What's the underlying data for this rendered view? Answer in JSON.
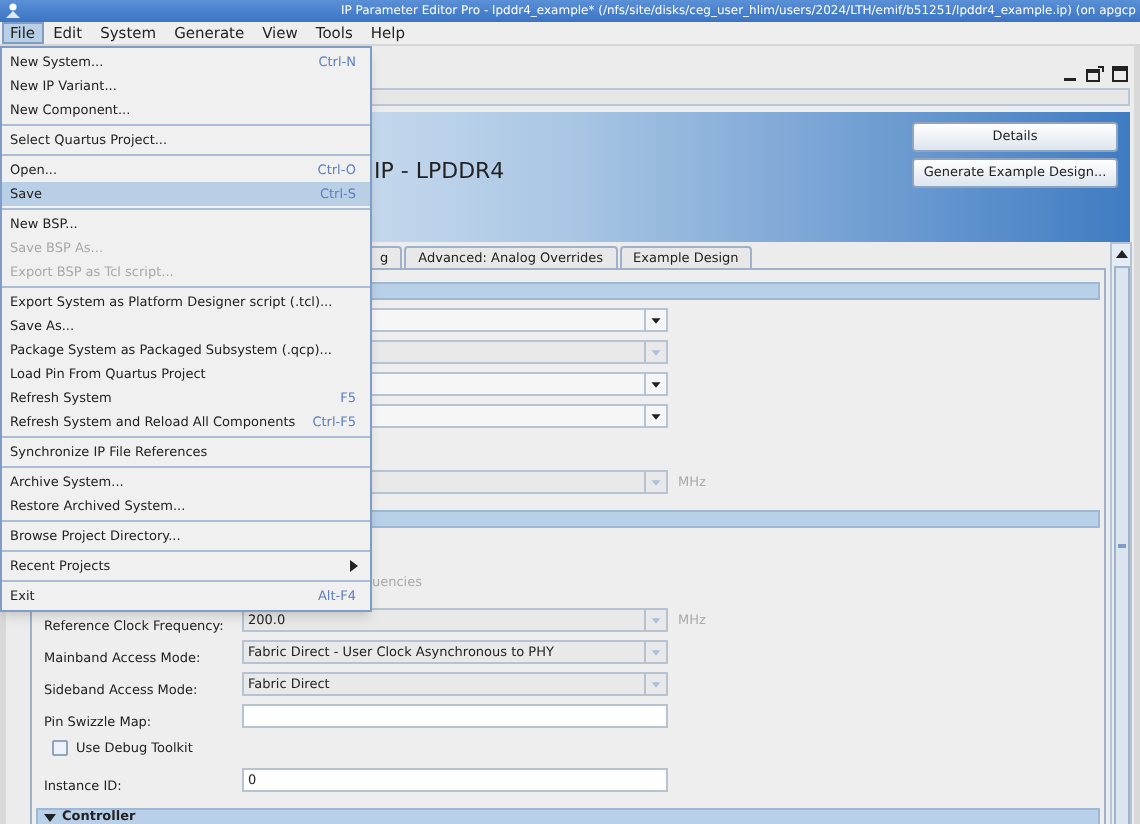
{
  "window": {
    "title": "IP Parameter Editor Pro - lpddr4_example* (/nfs/site/disks/ceg_user_hlim/users/2024/LTH/emif/b51251/lpddr4_example.ip) (on apgcp"
  },
  "menu_bar": [
    {
      "label": "File",
      "selected": true
    },
    {
      "label": "Edit",
      "selected": false
    },
    {
      "label": "System",
      "selected": false
    },
    {
      "label": "Generate",
      "selected": false
    },
    {
      "label": "View",
      "selected": false
    },
    {
      "label": "Tools",
      "selected": false
    },
    {
      "label": "Help",
      "selected": false
    }
  ],
  "file_menu": {
    "groups": [
      [
        {
          "label": "New System...",
          "shortcut": "Ctrl-N",
          "disabled": false,
          "selected": false
        },
        {
          "label": "New IP Variant...",
          "disabled": false,
          "selected": false
        },
        {
          "label": "New Component...",
          "disabled": false,
          "selected": false
        }
      ],
      [
        {
          "label": "Select Quartus Project...",
          "disabled": false,
          "selected": false
        }
      ],
      [
        {
          "label": "Open...",
          "shortcut": "Ctrl-O",
          "disabled": false,
          "selected": false
        },
        {
          "label": "Save",
          "shortcut": "Ctrl-S",
          "disabled": false,
          "selected": true
        }
      ],
      [
        {
          "label": "New BSP...",
          "disabled": false,
          "selected": false
        },
        {
          "label": "Save BSP As...",
          "disabled": true,
          "selected": false
        },
        {
          "label": "Export BSP as Tcl script...",
          "disabled": true,
          "selected": false
        }
      ],
      [
        {
          "label": "Export System as Platform Designer script (.tcl)...",
          "disabled": false,
          "selected": false
        },
        {
          "label": "Save As...",
          "disabled": false,
          "selected": false
        },
        {
          "label": "Package System as Packaged Subsystem (.qcp)...",
          "disabled": false,
          "selected": false
        },
        {
          "label": "Load Pin From Quartus Project",
          "disabled": false,
          "selected": false
        },
        {
          "label": "Refresh System",
          "shortcut": "F5",
          "disabled": false,
          "selected": false
        },
        {
          "label": "Refresh System and Reload All Components",
          "shortcut": "Ctrl-F5",
          "disabled": false,
          "selected": false
        }
      ],
      [
        {
          "label": "Synchronize IP File References",
          "disabled": false,
          "selected": false
        }
      ],
      [
        {
          "label": "Archive System...",
          "disabled": false,
          "selected": false
        },
        {
          "label": "Restore Archived System...",
          "disabled": false,
          "selected": false
        }
      ],
      [
        {
          "label": "Browse Project Directory...",
          "disabled": false,
          "selected": false
        }
      ],
      [
        {
          "label": "Recent Projects",
          "submenu": true,
          "disabled": false,
          "selected": false
        }
      ],
      [
        {
          "label": "Exit",
          "shortcut": "Alt-F4",
          "disabled": false,
          "selected": false
        }
      ]
    ]
  },
  "banner": {
    "title": "IP - LPDDR4",
    "buttons": [
      "Details",
      "Generate Example Design..."
    ]
  },
  "tabs": [
    {
      "label": "g",
      "selected": false
    },
    {
      "label": "Advanced: Analog Overrides",
      "selected": false
    },
    {
      "label": "Example Design",
      "selected": false
    }
  ],
  "sections": [
    {
      "fields": [
        {
          "kind": "dropdown",
          "disabled": false
        },
        {
          "kind": "dropdown",
          "disabled": true
        },
        {
          "kind": "dropdown",
          "disabled": false
        },
        {
          "kind": "dropdown",
          "disabled": false
        },
        {
          "kind": "dropdown",
          "disabled": true,
          "unit": "MHz"
        }
      ]
    },
    {
      "fields": [
        {
          "kind": "note",
          "text": "uencies"
        },
        {
          "kind": "dropdown",
          "label": "Reference Clock Frequency:",
          "value": "200.0",
          "unit": "MHz",
          "disabled": true
        },
        {
          "kind": "dropdown",
          "label": "Mainband Access Mode:",
          "value": "Fabric Direct - User Clock Asynchronous to PHY",
          "disabled": true
        },
        {
          "kind": "dropdown",
          "label": "Sideband Access Mode:",
          "value": "Fabric Direct",
          "disabled": true
        },
        {
          "kind": "text",
          "label": "Pin Swizzle Map:"
        },
        {
          "kind": "checkbox",
          "label": "Use Debug Toolkit",
          "checked": false
        },
        {
          "kind": "text",
          "label": "Instance ID:",
          "value": "0"
        }
      ]
    },
    {
      "title": "Controller"
    }
  ]
}
